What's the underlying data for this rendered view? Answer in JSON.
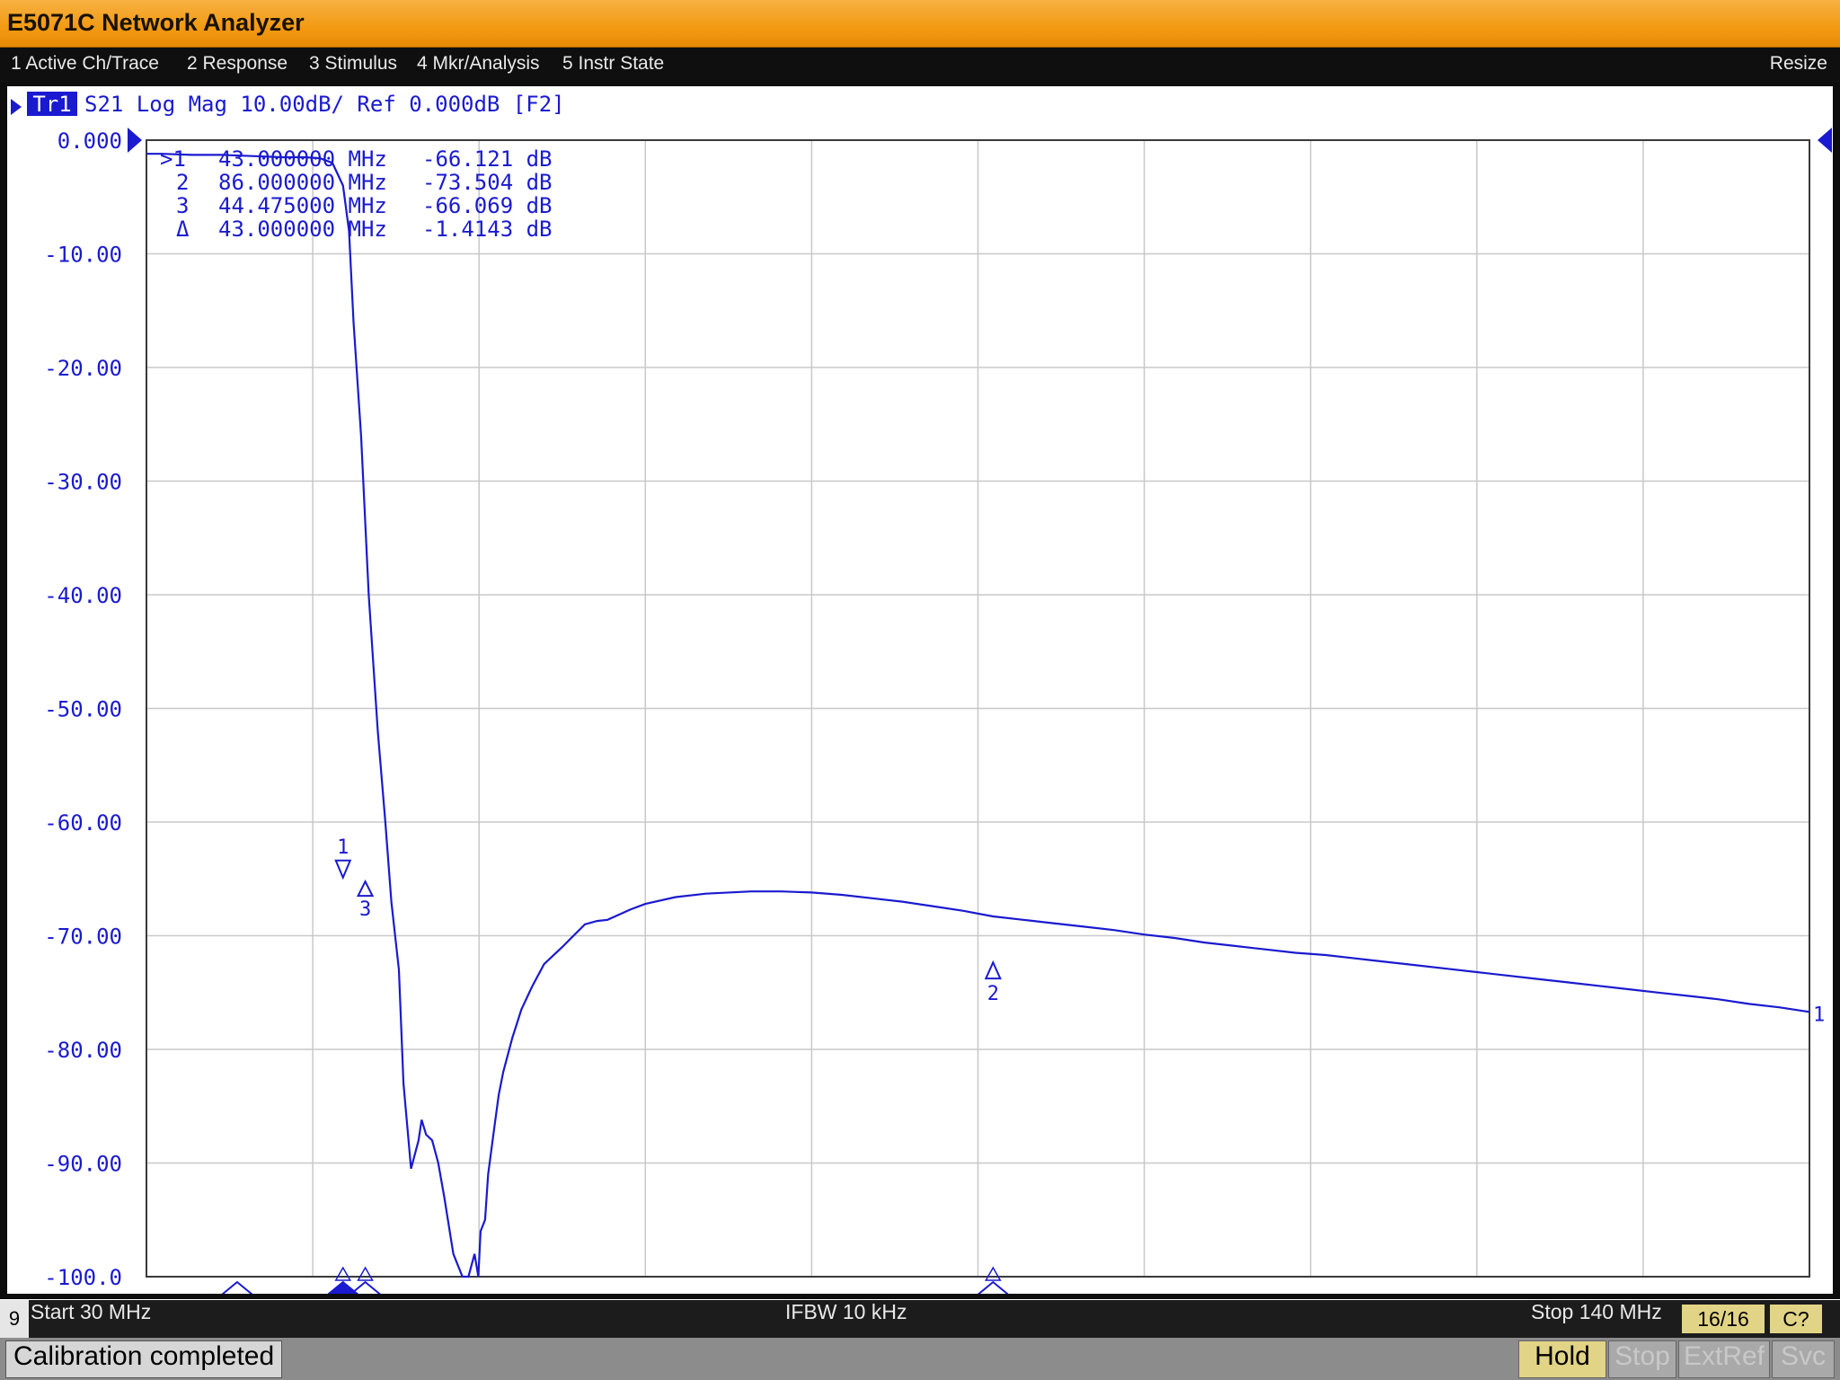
{
  "app": {
    "title": "E5071C Network Analyzer"
  },
  "menu": {
    "items": [
      "1 Active Ch/Trace",
      "2 Response",
      "3 Stimulus",
      "4 Mkr/Analysis",
      "5 Instr State"
    ],
    "resize": "Resize"
  },
  "trace": {
    "tag": "Tr1",
    "header": "S21 Log Mag 10.00dB/ Ref 0.000dB [F2]"
  },
  "markers": {
    "readout": [
      {
        "id": ">1",
        "freq": "43.000000 MHz",
        "value": "-66.121 dB"
      },
      {
        "id": "2",
        "freq": "86.000000 MHz",
        "value": "-73.504 dB"
      },
      {
        "id": "3",
        "freq": "44.475000 MHz",
        "value": "-66.069 dB"
      },
      {
        "id": "Δ",
        "freq": "43.000000 MHz",
        "value": "-1.4143 dB"
      }
    ],
    "labels": [
      "1",
      "2",
      "3"
    ],
    "right_edge_label": "1"
  },
  "status": {
    "channel": "9",
    "start": "Start 30 MHz",
    "ifbw": "IFBW 10 kHz",
    "stop": "Stop 140 MHz",
    "points": "16/16",
    "cal": "C?"
  },
  "bottom": {
    "message": "Calibration completed",
    "buttons": [
      "Hold",
      "Stop",
      "ExtRef",
      "Svc"
    ]
  },
  "colors": {
    "trace": "#1a1ad0",
    "grid": "#c8c8c8",
    "title_bar": "#f29a12",
    "highlight": "#e2d486"
  },
  "chart_data": {
    "type": "line",
    "xlabel": "",
    "ylabel": "",
    "xlim": [
      30,
      140
    ],
    "ylim": [
      -100,
      0
    ],
    "x_divisions": 10,
    "y_ticks": [
      "0.000",
      "-10.00",
      "-20.00",
      "-30.00",
      "-40.00",
      "-50.00",
      "-60.00",
      "-70.00",
      "-80.00",
      "-90.00",
      "-100.0"
    ],
    "grid": true,
    "series": [
      {
        "x": [
          30,
          31,
          33,
          35,
          37,
          39,
          40.5,
          41.5,
          42.3,
          43,
          43.4,
          43.7,
          44.2,
          44.7,
          45.3,
          45.8,
          46.2,
          46.7,
          47.0,
          47.5,
          48.0,
          48.2,
          48.5,
          48.9,
          49.3,
          49.7,
          50.3,
          50.9,
          51.3,
          51.5,
          51.7,
          51.95,
          52.1,
          52.4,
          52.6,
          53.0,
          53.3,
          53.6,
          54.2,
          54.8,
          55.5,
          56.3,
          57.5,
          59,
          59.8,
          60.5,
          62,
          63,
          65,
          67,
          70,
          72,
          74,
          76,
          78,
          80,
          82,
          84,
          86,
          88,
          90,
          92,
          94,
          96,
          98,
          100,
          102,
          104,
          106,
          108,
          110,
          112,
          114,
          116,
          118,
          120,
          122,
          124,
          126,
          128,
          130,
          132,
          134,
          136,
          138,
          140
        ],
        "y": [
          -1.2,
          -1.2,
          -1.3,
          -1.3,
          -1.4,
          -1.5,
          -1.5,
          -1.6,
          -2.0,
          -4.0,
          -8,
          -16,
          -26,
          -40,
          -52,
          -60,
          -67,
          -73,
          -83,
          -90.5,
          -88,
          -86.2,
          -87.5,
          -88,
          -90,
          -93,
          -98,
          -100,
          -100,
          -99,
          -98,
          -100,
          -96,
          -95,
          -91,
          -87,
          -84,
          -82,
          -79,
          -76.5,
          -74.5,
          -72.5,
          -71,
          -69,
          -68.7,
          -68.6,
          -67.7,
          -67.2,
          -66.6,
          -66.3,
          -66.1,
          -66.1,
          -66.2,
          -66.4,
          -66.7,
          -67.0,
          -67.4,
          -67.8,
          -68.3,
          -68.6,
          -68.9,
          -69.2,
          -69.5,
          -69.9,
          -70.2,
          -70.6,
          -70.9,
          -71.2,
          -71.5,
          -71.7,
          -72.0,
          -72.3,
          -72.6,
          -72.9,
          -73.2,
          -73.5,
          -73.8,
          -74.1,
          -74.4,
          -74.7,
          -75.0,
          -75.3,
          -75.6,
          -76.0,
          -76.3,
          -76.7
        ]
      }
    ],
    "marker_points": [
      {
        "label": "1",
        "x": 43.0,
        "y": -66.121
      },
      {
        "label": "2",
        "x": 86.0,
        "y": -73.504
      },
      {
        "label": "3",
        "x": 44.475,
        "y": -66.069
      }
    ]
  }
}
